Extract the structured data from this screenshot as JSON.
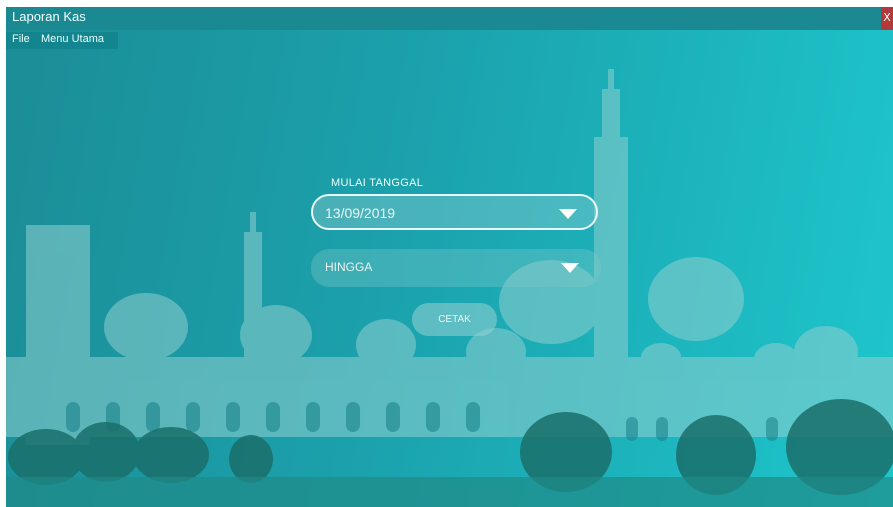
{
  "window": {
    "title": "Laporan Kas",
    "close_label": "X"
  },
  "menu": {
    "items": [
      {
        "label": "File"
      },
      {
        "label": "Menu Utama"
      }
    ]
  },
  "form": {
    "mulai_label": "MULAI TANGGAL",
    "mulai_value": "13/09/2019",
    "hingga_value": "HINGGA",
    "cetak_label": "CETAK"
  },
  "colors": {
    "accent": "#1ba2ad",
    "titlebar": "#1b8992",
    "close": "#b33a3a"
  },
  "icons": [
    "dropdown-arrow-icon",
    "close-icon"
  ]
}
